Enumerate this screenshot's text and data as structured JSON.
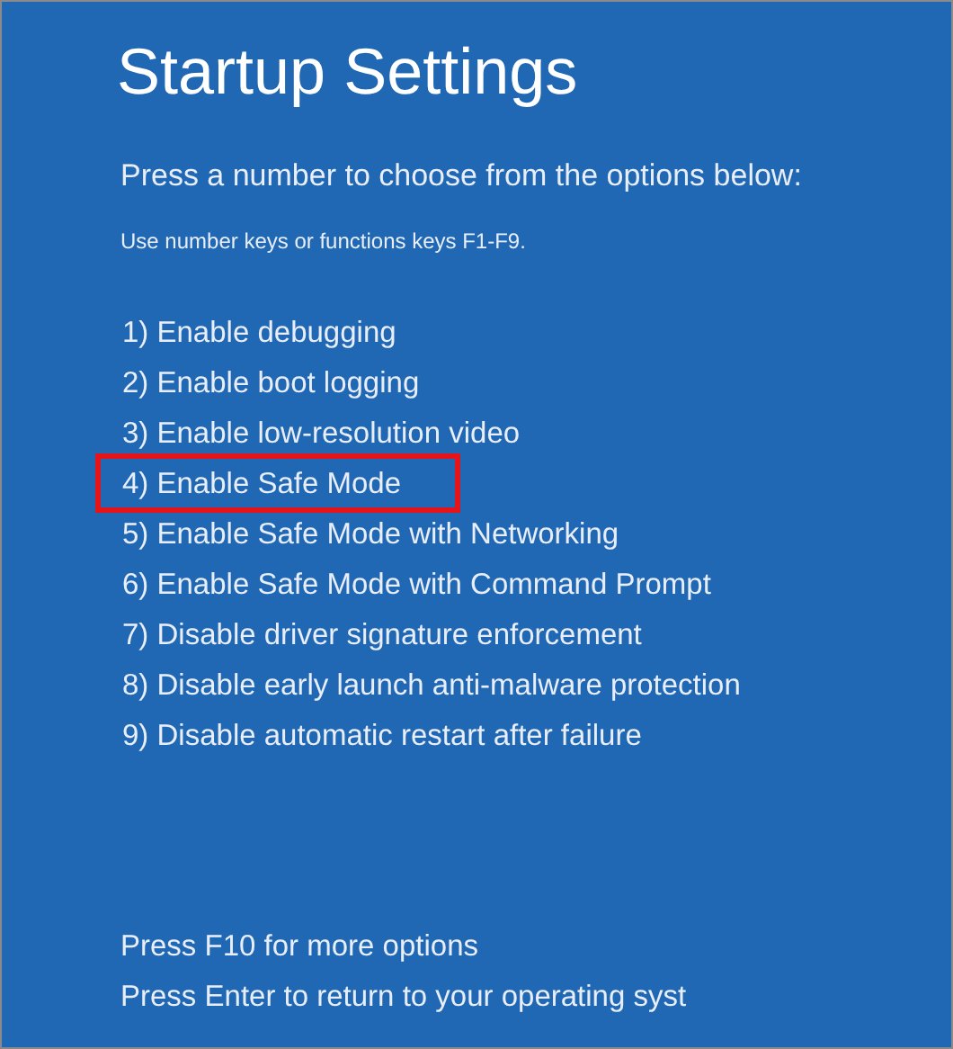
{
  "title": "Startup Settings",
  "prompt": "Press a number to choose from the options below:",
  "hint": "Use number keys or functions keys F1-F9.",
  "options": [
    {
      "label": "1) Enable debugging",
      "highlighted": false
    },
    {
      "label": "2) Enable boot logging",
      "highlighted": false
    },
    {
      "label": "3) Enable low-resolution video",
      "highlighted": false
    },
    {
      "label": "4) Enable Safe Mode",
      "highlighted": true
    },
    {
      "label": "5) Enable Safe Mode with Networking",
      "highlighted": false
    },
    {
      "label": "6) Enable Safe Mode with Command Prompt",
      "highlighted": false
    },
    {
      "label": "7) Disable driver signature enforcement",
      "highlighted": false
    },
    {
      "label": "8) Disable early launch anti-malware protection",
      "highlighted": false
    },
    {
      "label": "9) Disable automatic restart after failure",
      "highlighted": false
    }
  ],
  "footer": [
    "Press F10 for more options",
    "Press Enter to return to your operating syst"
  ]
}
